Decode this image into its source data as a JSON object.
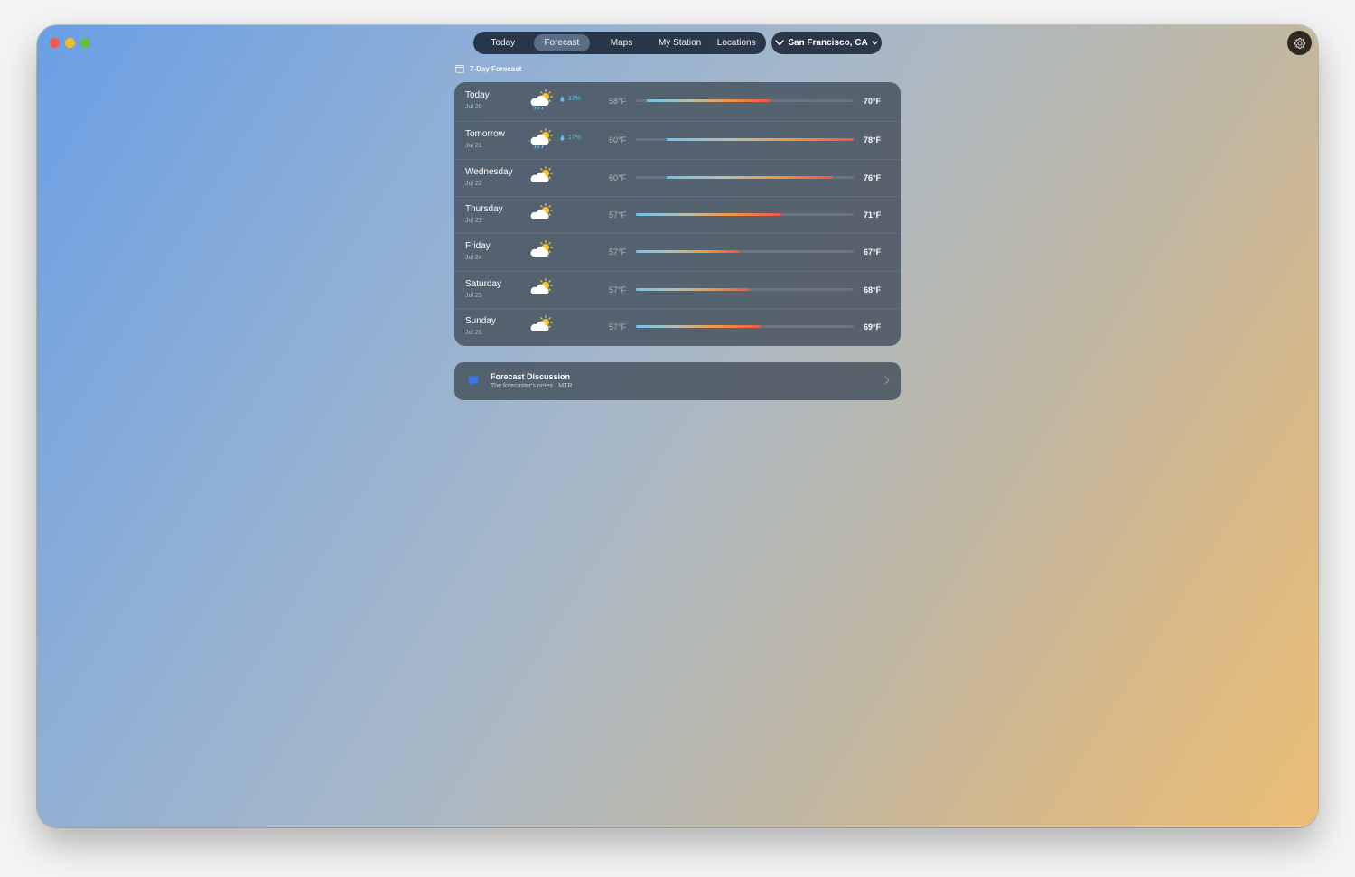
{
  "nav": {
    "tabs": [
      {
        "label": "Today"
      },
      {
        "label": "Forecast"
      },
      {
        "label": "Maps"
      },
      {
        "label": "My Station"
      },
      {
        "label": "Locations"
      }
    ],
    "active_tab": "Forecast",
    "location": "San Francisco, CA"
  },
  "forecast": {
    "title": "7-Day Forecast",
    "days": [
      {
        "day": "Today",
        "date": "Jul 20",
        "icon": "partly-cloudy-rain-icon",
        "precip": "17%",
        "low": "58°F",
        "high": "70°F"
      },
      {
        "day": "Tomorrow",
        "date": "Jul 21",
        "icon": "partly-cloudy-rain-icon",
        "precip": "17%",
        "low": "60°F",
        "high": "78°F"
      },
      {
        "day": "Wednesday",
        "date": "Jul 22",
        "icon": "partly-cloudy-icon",
        "precip": "",
        "low": "60°F",
        "high": "76°F"
      },
      {
        "day": "Thursday",
        "date": "Jul 23",
        "icon": "partly-cloudy-icon",
        "precip": "",
        "low": "57°F",
        "high": "71°F"
      },
      {
        "day": "Friday",
        "date": "Jul 24",
        "icon": "partly-cloudy-icon",
        "precip": "",
        "low": "57°F",
        "high": "67°F"
      },
      {
        "day": "Saturday",
        "date": "Jul 25",
        "icon": "partly-cloudy-icon",
        "precip": "",
        "low": "57°F",
        "high": "68°F"
      },
      {
        "day": "Sunday",
        "date": "Jul 26",
        "icon": "partly-cloudy-icon",
        "precip": "",
        "low": "57°F",
        "high": "69°F"
      }
    ],
    "range_scale_low": 57,
    "range_scale_high": 78
  },
  "discussion": {
    "title": "Forecast Discussion",
    "subtitle": "The forecaster's notes · MTR"
  },
  "colors": {
    "precip": "#61bdf0",
    "discussion_icon": "#3a78e0",
    "gradient_cool": "#6ec4f0",
    "gradient_warm": "#ee5549"
  }
}
